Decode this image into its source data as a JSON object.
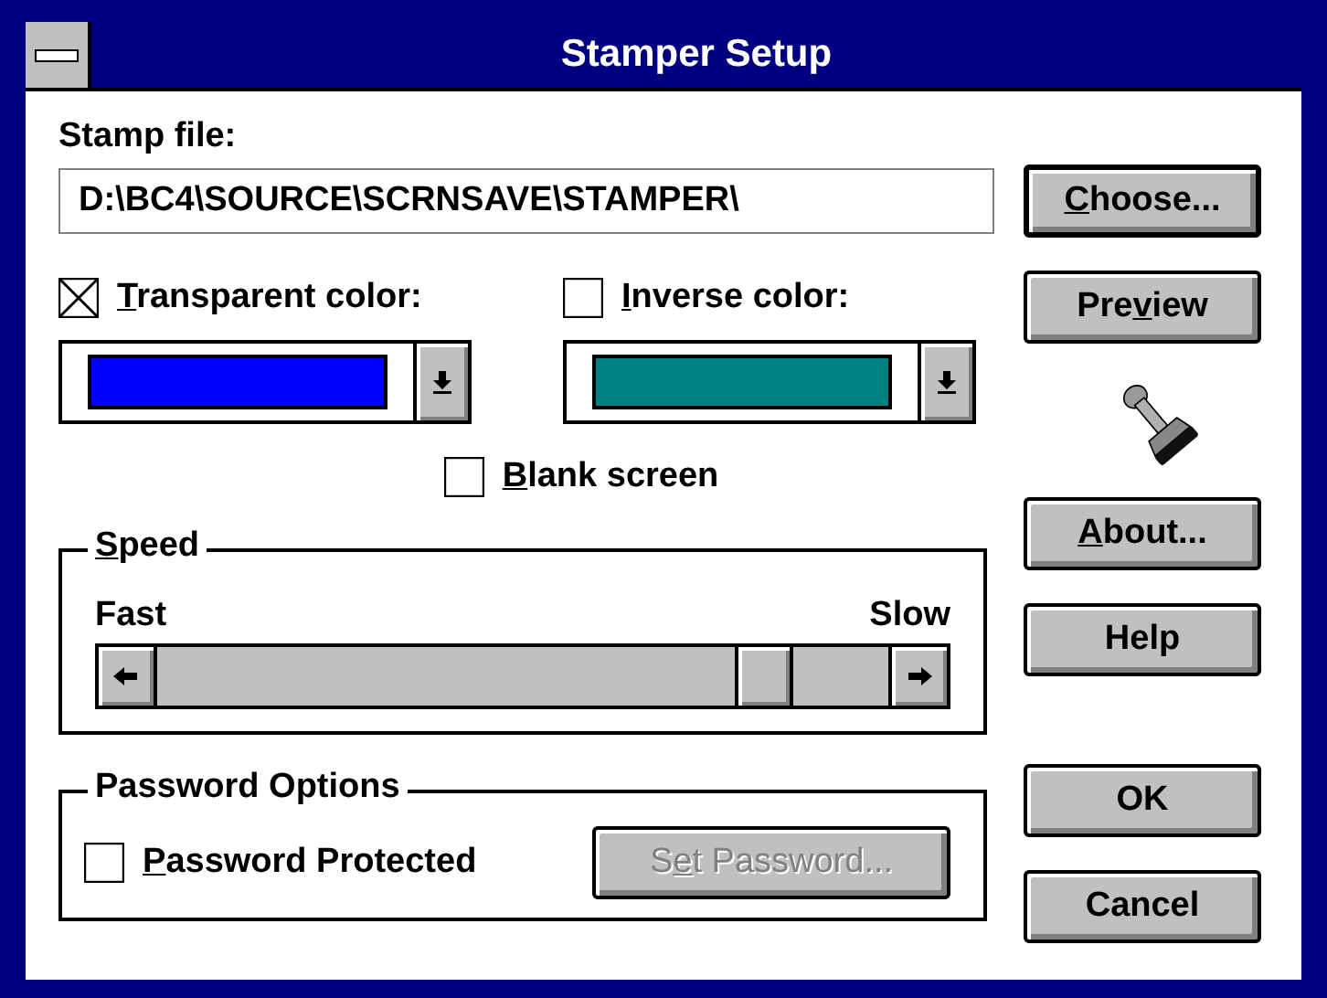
{
  "window": {
    "title": "Stamper Setup"
  },
  "stamp_file": {
    "label": "Stamp file:",
    "value": "D:\\BC4\\SOURCE\\SCRNSAVE\\STAMPER\\"
  },
  "color_options": [
    {
      "label": [
        {
          "text": "T",
          "underline": true
        },
        {
          "text": "ransparent color:",
          "underline": false
        }
      ],
      "checked": true,
      "color": "#0000ff"
    },
    {
      "label": [
        {
          "text": "I",
          "underline": true
        },
        {
          "text": "nverse color:",
          "underline": false
        }
      ],
      "checked": false,
      "color": "#008080"
    }
  ],
  "blank_screen": {
    "label": [
      {
        "text": "B",
        "underline": true
      },
      {
        "text": "lank screen",
        "underline": false
      }
    ],
    "checked": false
  },
  "speed": {
    "label": [
      {
        "text": "S",
        "underline": true
      },
      {
        "text": "peed",
        "underline": false
      }
    ],
    "min_label": "Fast",
    "max_label": "Slow"
  },
  "password": {
    "label": "Password Options",
    "protected": {
      "label": [
        {
          "text": "P",
          "underline": true
        },
        {
          "text": "assword Protected",
          "underline": false
        }
      ],
      "checked": false
    },
    "set_button": {
      "label": [
        {
          "text": "S",
          "underline": false
        },
        {
          "text": "e",
          "underline": true
        },
        {
          "text": "t Password...",
          "underline": false
        }
      ],
      "disabled": true
    }
  },
  "buttons": [
    {
      "label": [
        {
          "text": "C",
          "underline": true
        },
        {
          "text": "hoose...",
          "underline": false
        }
      ],
      "default": true
    },
    {
      "label": [
        {
          "text": "Pre",
          "underline": false
        },
        {
          "text": "v",
          "underline": true
        },
        {
          "text": "iew",
          "underline": false
        }
      ],
      "default": false
    },
    {
      "label": [
        {
          "text": "A",
          "underline": true
        },
        {
          "text": "bout...",
          "underline": false
        }
      ],
      "default": false
    },
    {
      "label": [
        {
          "text": "Help",
          "underline": false
        }
      ],
      "default": false
    },
    {
      "label": [
        {
          "text": "OK",
          "underline": false
        }
      ],
      "default": false
    },
    {
      "label": [
        {
          "text": "Cancel",
          "underline": false
        }
      ],
      "default": false
    }
  ]
}
